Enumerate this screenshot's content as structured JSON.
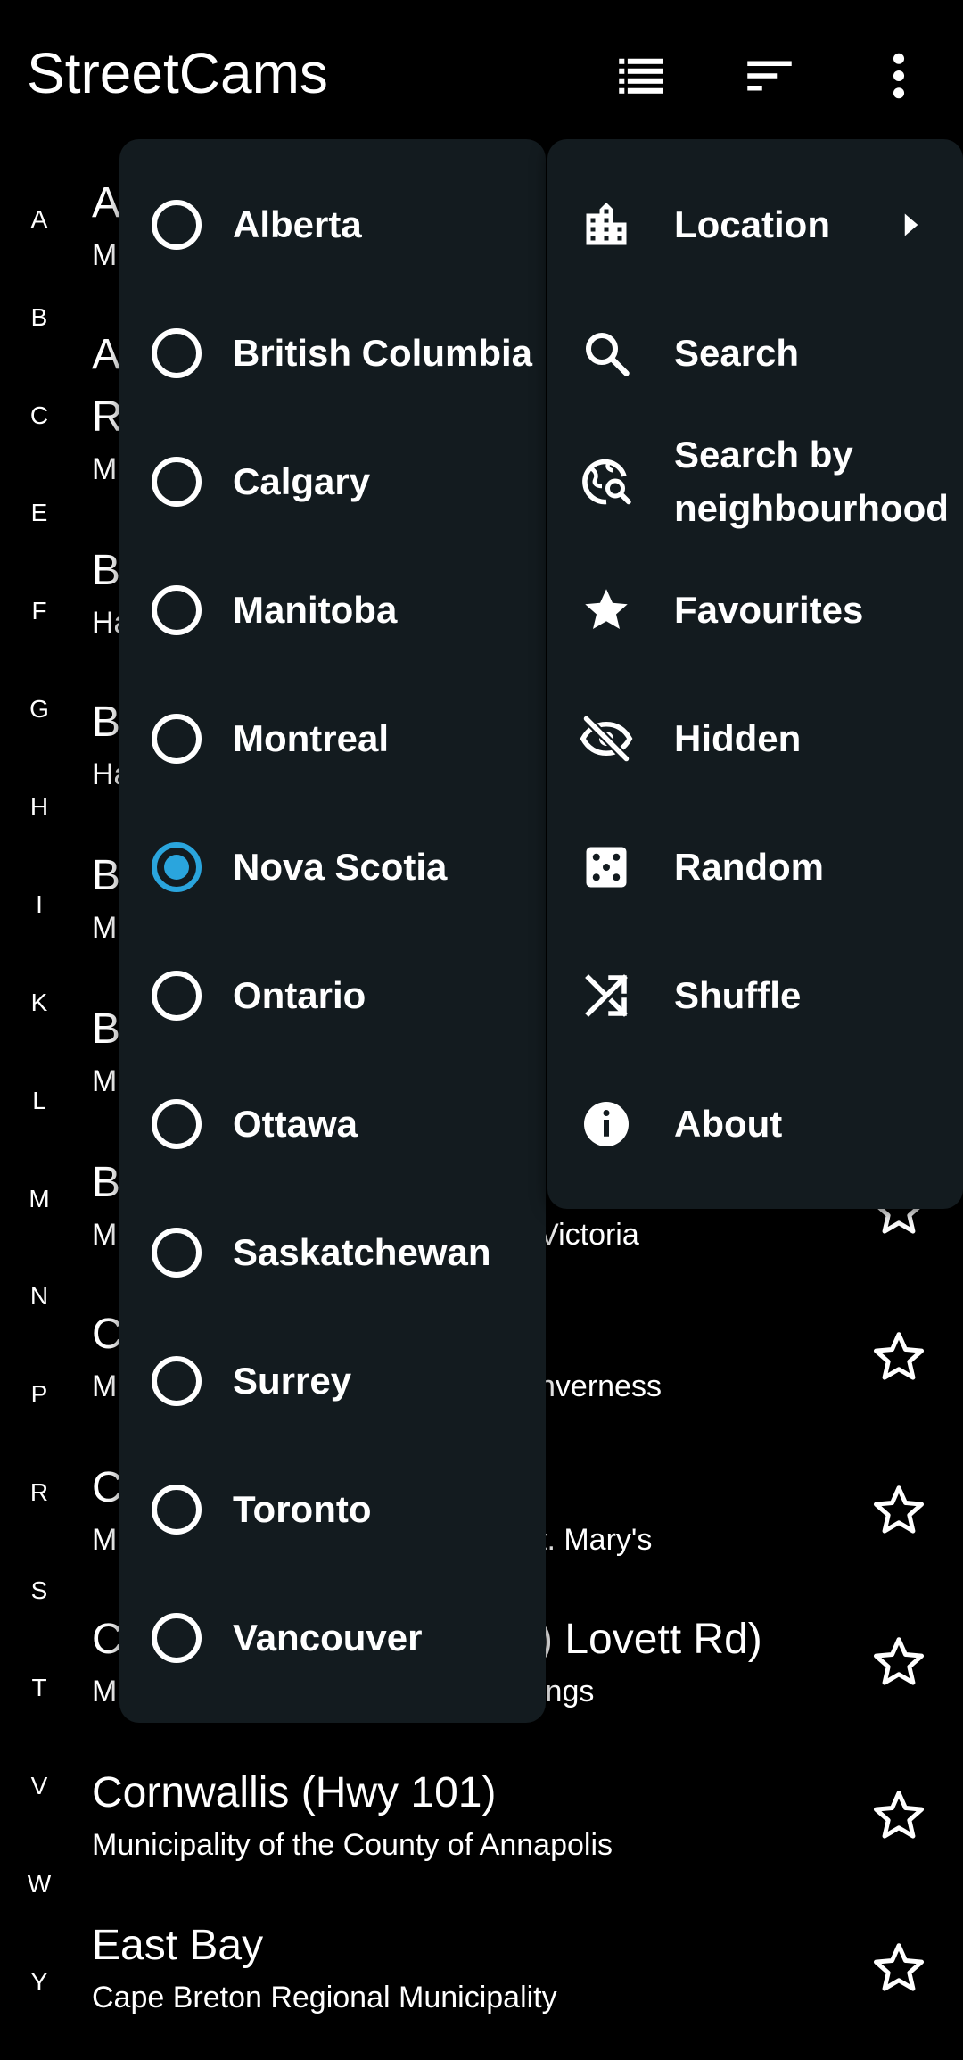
{
  "app": {
    "title": "StreetCams"
  },
  "toolbar": {
    "list_view_icon": "list-icon",
    "sort_icon": "sort-icon",
    "more_icon": "more-vert-icon"
  },
  "index_letters": [
    "A",
    "B",
    "C",
    "E",
    "F",
    "G",
    "H",
    "I",
    "K",
    "L",
    "M",
    "N",
    "P",
    "R",
    "S",
    "T",
    "V",
    "W",
    "Y"
  ],
  "cameras": [
    {
      "title": "A",
      "subtitle": "M"
    },
    {
      "title": "A",
      "subtitle": ""
    },
    {
      "title": "R",
      "subtitle": "M"
    },
    {
      "title": "B",
      "subtitle": "Ha"
    },
    {
      "title": "B",
      "subtitle": "Ha"
    },
    {
      "title": "B",
      "subtitle": "M"
    },
    {
      "title": "B",
      "subtitle": "M"
    },
    {
      "title": "B",
      "subtitle": "M",
      "subtitle_right": "Victoria"
    },
    {
      "title": "C",
      "subtitle": "M",
      "subtitle_right": "nverness"
    },
    {
      "title": "C",
      "subtitle": "M",
      "subtitle_right": "t. Mary's"
    },
    {
      "title": "C",
      "title_right": ") Lovett Rd)",
      "subtitle": "M",
      "subtitle_right": "ings"
    },
    {
      "title": "Cornwallis (Hwy 101)",
      "subtitle": "Municipality of the County of Annapolis"
    },
    {
      "title": "East Bay",
      "subtitle": "Cape Breton Regional Municipality"
    }
  ],
  "location_menu": {
    "selected": "Nova Scotia",
    "items": [
      "Alberta",
      "British Columbia",
      "Calgary",
      "Manitoba",
      "Montreal",
      "Nova Scotia",
      "Ontario",
      "Ottawa",
      "Saskatchewan",
      "Surrey",
      "Toronto",
      "Vancouver"
    ]
  },
  "options_menu": {
    "items": [
      {
        "label": "Location",
        "icon": "location-city-icon",
        "has_submenu": true
      },
      {
        "label": "Search",
        "icon": "search-icon"
      },
      {
        "label": "Search by neighbourhood",
        "icon": "travel-explore-icon"
      },
      {
        "label": "Favourites",
        "icon": "star-icon"
      },
      {
        "label": "Hidden",
        "icon": "visibility-off-icon"
      },
      {
        "label": "Random",
        "icon": "dice-icon"
      },
      {
        "label": "Shuffle",
        "icon": "shuffle-icon"
      },
      {
        "label": "About",
        "icon": "info-icon"
      }
    ]
  },
  "colors": {
    "background": "#000000",
    "menu": "#131b1f",
    "accent": "#2aa5dd"
  }
}
